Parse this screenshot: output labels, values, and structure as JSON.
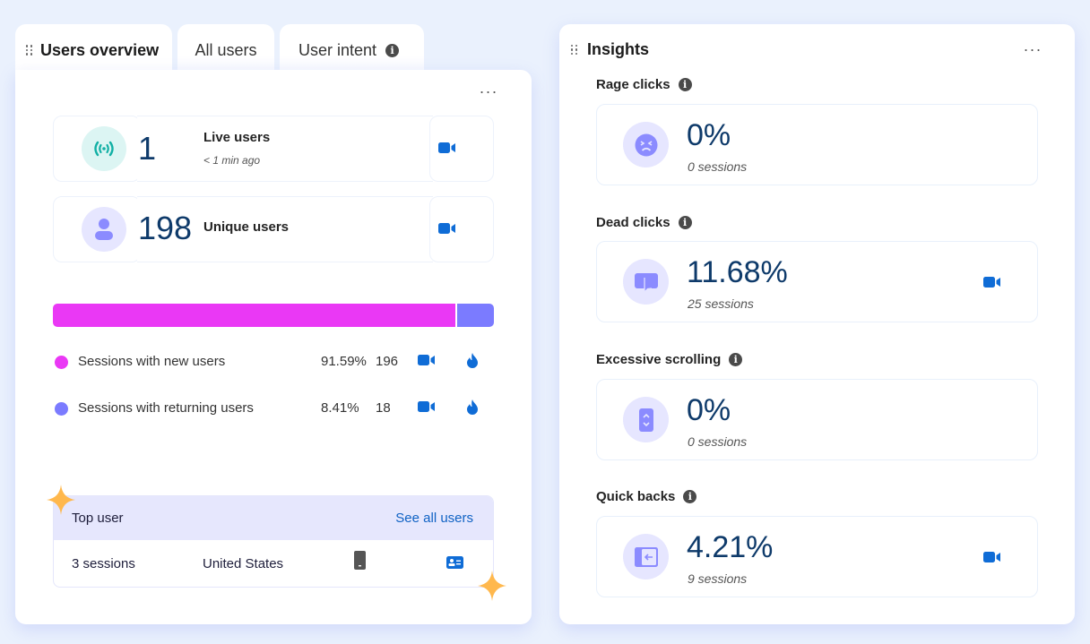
{
  "users_widget": {
    "tabs": [
      {
        "label": "Users overview",
        "active": true
      },
      {
        "label": "All users",
        "active": false
      },
      {
        "label": "User intent",
        "active": false,
        "has_info": true
      }
    ],
    "more_label": "...",
    "live_users": {
      "value": "1",
      "label": "Live users",
      "subtitle": "< 1 min ago",
      "icon": "broadcast-icon"
    },
    "unique_users": {
      "value": "198",
      "label": "Unique users",
      "icon": "person-icon"
    },
    "session_split": {
      "colors": {
        "new": "#ea38f5",
        "returning": "#7b7bff"
      },
      "new_fraction": 0.9159,
      "returning_fraction": 0.0841,
      "rows": [
        {
          "label": "Sessions with new users",
          "percent": "91.59%",
          "count": "196"
        },
        {
          "label": "Sessions with returning users",
          "percent": "8.41%",
          "count": "18"
        }
      ]
    },
    "top_user": {
      "title": "Top user",
      "link": "See all users",
      "sessions": "3 sessions",
      "country": "United States",
      "device_icon": "mobile-phone-icon",
      "profile_icon": "contact-card-icon"
    }
  },
  "insights": {
    "title": "Insights",
    "more_label": "...",
    "items": [
      {
        "label": "Rage clicks",
        "value": "0%",
        "sessions": "0 sessions",
        "icon": "angry-face-icon",
        "has_recording": false
      },
      {
        "label": "Dead clicks",
        "value": "11.68%",
        "sessions": "25 sessions",
        "icon": "dead-click-icon",
        "has_recording": true
      },
      {
        "label": "Excessive scrolling",
        "value": "0%",
        "sessions": "0 sessions",
        "icon": "scroll-icon",
        "has_recording": false
      },
      {
        "label": "Quick backs",
        "value": "4.21%",
        "sessions": "9 sessions",
        "icon": "quick-back-icon",
        "has_recording": true
      }
    ]
  },
  "colors": {
    "accent_blue": "#0f6cd6",
    "number_navy": "#0e3a6a",
    "icon_purple": "#8b8bff",
    "icon_bg_purple": "#e6e6ff",
    "icon_teal": "#12b0a5",
    "icon_bg_teal": "#dcf5f3",
    "sparkle": "#ffb84d"
  }
}
